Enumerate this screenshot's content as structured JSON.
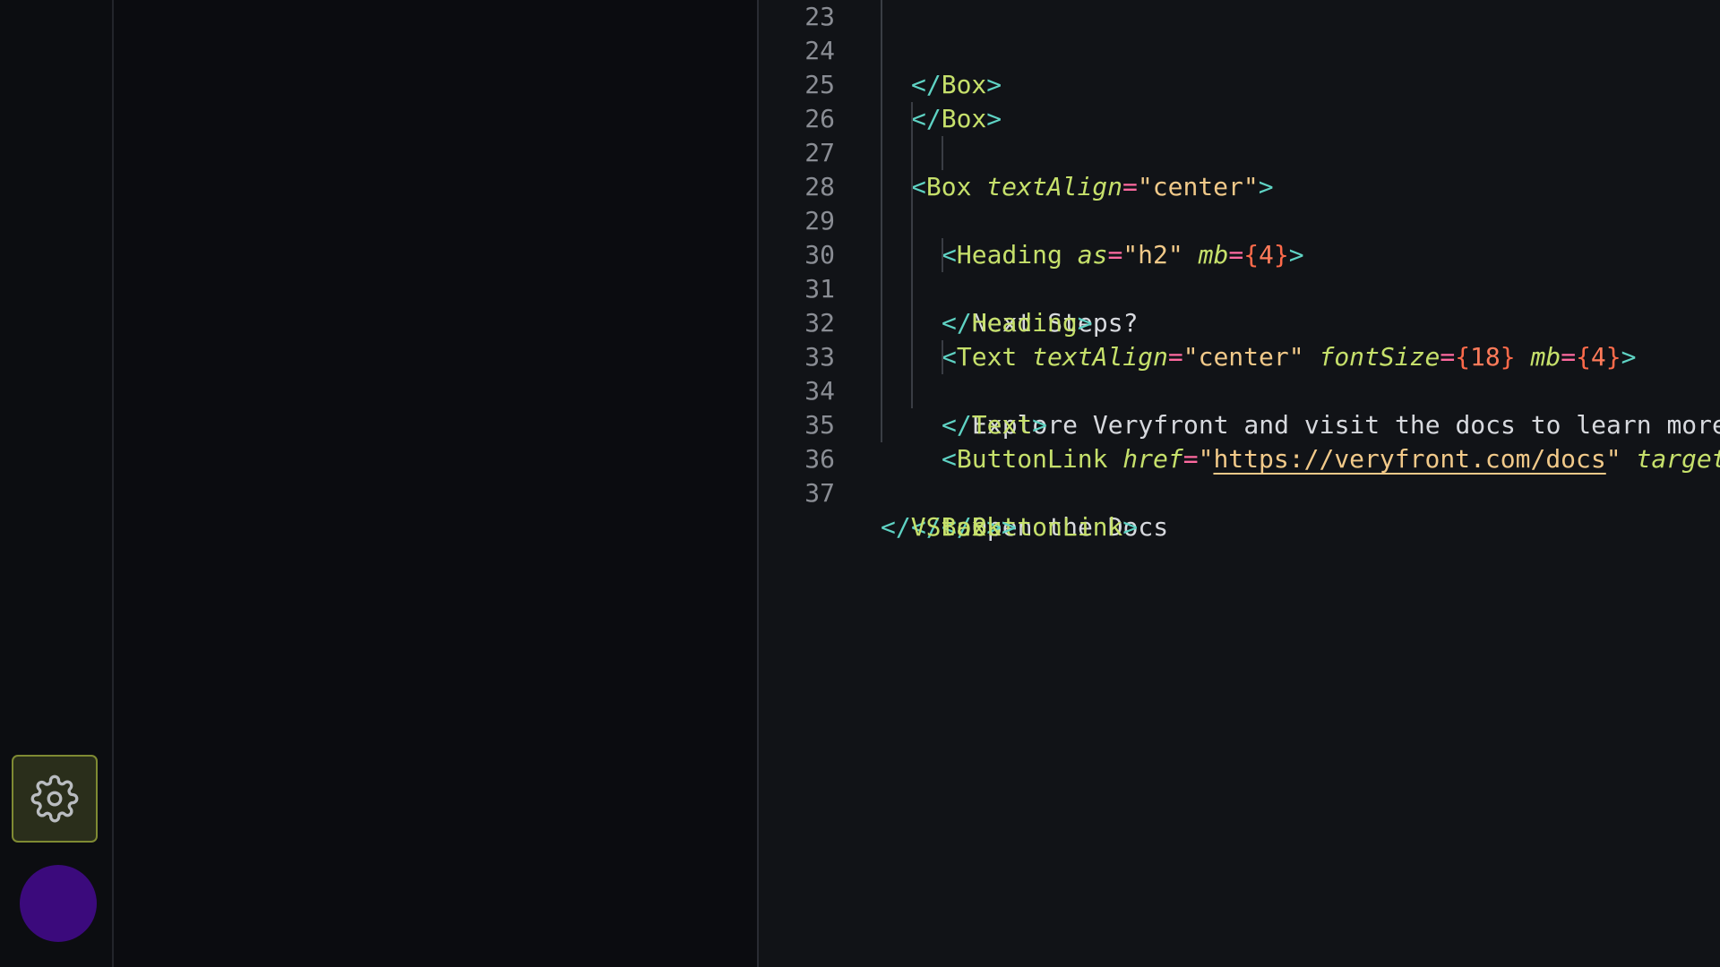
{
  "sidebar": {
    "settings_icon": "gear-icon",
    "avatar_color": "#3b0a7c"
  },
  "editor": {
    "lines": [
      {
        "num": "23",
        "text": "</Box>"
      },
      {
        "num": "24",
        "text": "</Box>"
      },
      {
        "num": "25",
        "text": ""
      },
      {
        "num": "26",
        "text": "<Box textAlign=\"center\">"
      },
      {
        "num": "27",
        "text": "<Heading as=\"h2\" mb={4}>"
      },
      {
        "num": "28",
        "text": "Next Steps?"
      },
      {
        "num": "29",
        "text": "</Heading>"
      },
      {
        "num": "30",
        "text": "<Text textAlign=\"center\" fontSize={18} mb={4}>"
      },
      {
        "num": "31",
        "text": "Explore Veryfront and visit the docs to learn more"
      },
      {
        "num": "32",
        "text": "</Text>"
      },
      {
        "num": "33",
        "text": "<ButtonLink href=\"https://veryfront.com/docs\" target"
      },
      {
        "num": "34",
        "text": "Open the Docs"
      },
      {
        "num": "35",
        "text": "</ButtonLink>"
      },
      {
        "num": "36",
        "text": "</Box>"
      },
      {
        "num": "37",
        "text": "</VStack>"
      }
    ],
    "tokens": {
      "box": "Box",
      "heading": "Heading",
      "text_tag": "Text",
      "buttonlink": "ButtonLink",
      "vstack": "VStack",
      "attr_textalign": "textAlign",
      "attr_as": "as",
      "attr_mb": "mb",
      "attr_fontsize": "fontSize",
      "attr_href": "href",
      "attr_target": "target",
      "val_center": "center",
      "val_h2": "h2",
      "val_4": "4",
      "val_18": "18",
      "val_url": "https://veryfront.com/docs",
      "content_next_steps": "Next Steps?",
      "content_explore": "Explore Veryfront and visit the docs to learn more",
      "content_open_docs": "Open the Docs"
    }
  },
  "colors": {
    "tag_punct": "#5fd3c4",
    "tag_name": "#c6e06b",
    "equals": "#ff6aa0",
    "string": "#f1c989",
    "brace": "#ff6a4a",
    "line_number": "#8a8d94"
  }
}
